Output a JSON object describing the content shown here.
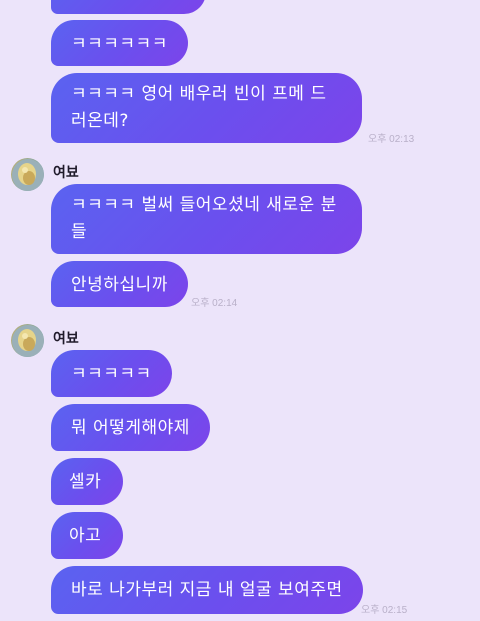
{
  "messages": {
    "m0": "",
    "m1": "ㅋㅋㅋㅋㅋㅋ",
    "m2": "ㅋㅋㅋㅋ 영어 배우러 빈이 프메 드러온데?",
    "m2_time": "오후 02:13",
    "sender1": "여뵤",
    "m3": "ㅋㅋㅋㅋ 벌써 들어오셨네 새로운 분들",
    "m4": "안녕하십니까",
    "m4_time": "오후 02:14",
    "sender2": "여뵤",
    "m5": "ㅋㅋㅋㅋㅋ",
    "m6": "뭐 어떻게해야제",
    "m7": "셀카",
    "m8": "아고",
    "m9": "바로 나가부러 지금 내 얼굴 보여주면",
    "m9_time": "오후 02:15"
  },
  "colors": {
    "background": "#ECE4FA",
    "bubble_start": "#5A63F0",
    "bubble_end": "#7C44EA",
    "timestamp": "#B9B0C9"
  }
}
